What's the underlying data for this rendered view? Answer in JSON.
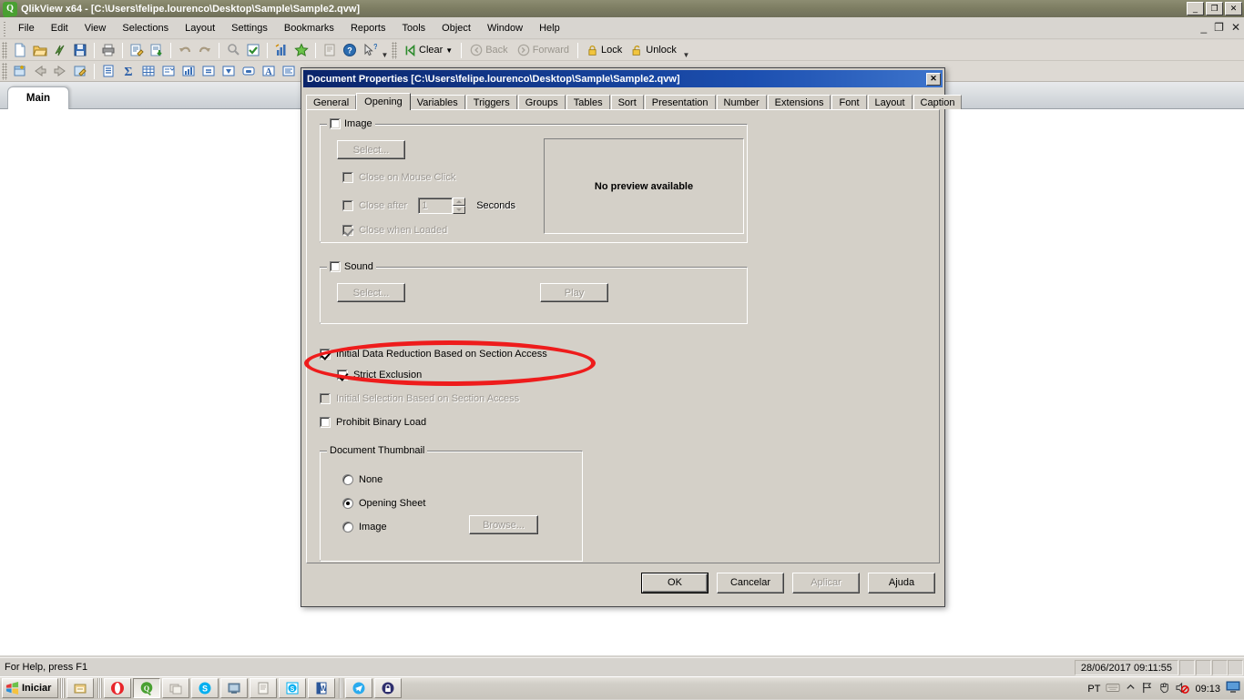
{
  "app": {
    "title": "QlikView x64 - [C:\\Users\\felipe.lourenco\\Desktop\\Sample\\Sample2.qvw]",
    "icon": "qlikview-logo-icon",
    "window_buttons": [
      {
        "name": "minimize",
        "glyph": "_"
      },
      {
        "name": "restore",
        "glyph": "❐"
      },
      {
        "name": "close",
        "glyph": "✕"
      }
    ],
    "mdi_buttons": [
      {
        "name": "minimize",
        "glyph": "_"
      },
      {
        "name": "restore",
        "glyph": "❐"
      },
      {
        "name": "close",
        "glyph": "✕"
      }
    ],
    "menu": [
      "File",
      "Edit",
      "View",
      "Selections",
      "Layout",
      "Settings",
      "Bookmarks",
      "Reports",
      "Tools",
      "Object",
      "Window",
      "Help"
    ],
    "toolbar_standard": [
      "new-document-icon",
      "open-document-icon",
      "reload-icon",
      "save-icon",
      "print-icon",
      "edit-script-icon",
      "load-data-icon",
      "undo-icon",
      "redo-icon",
      "search-icon",
      "current-selections-icon",
      "statistics-icon",
      "favorites-icon",
      "notes-icon",
      "help-icon",
      "context-help-icon"
    ],
    "toolbar_navigation": {
      "clear_label": "Clear",
      "back_label": "Back",
      "forward_label": "Forward",
      "lock_label": "Lock",
      "unlock_label": "Unlock"
    },
    "toolbar_design": [
      "new-sheet-icon",
      "promote-sheet-icon",
      "demote-sheet-icon",
      "sheet-properties-icon",
      "list-box-icon",
      "statistics-box-icon",
      "table-box-icon",
      "multi-box-icon",
      "chart-icon",
      "input-box-icon",
      "current-selections-box-icon",
      "button-icon",
      "text-object-icon",
      "slider-icon"
    ],
    "sheet_tabs": [
      {
        "label": "Main",
        "active": true
      }
    ],
    "status": {
      "help_text": "For Help, press F1",
      "clock": "28/06/2017 09:11:55"
    },
    "taskbar": {
      "start_label": "Iniciar",
      "items": [
        {
          "name": "windows-explorer-icon",
          "active": false
        },
        {
          "name": "opera-browser-icon",
          "active": false
        },
        {
          "name": "qlikview-icon",
          "active": true
        },
        {
          "name": "file-manager-icon",
          "active": false
        },
        {
          "name": "skype-icon",
          "active": false
        },
        {
          "name": "remote-desktop-icon",
          "active": false
        },
        {
          "name": "notepad-icon",
          "active": false
        },
        {
          "name": "skype-business-icon",
          "active": false
        },
        {
          "name": "word-icon",
          "active": false
        },
        {
          "name": "telegram-icon",
          "active": false
        },
        {
          "name": "lock-app-icon",
          "active": false
        }
      ],
      "tray_language": "PT",
      "tray_icons": [
        "keyboard-icon",
        "show-hidden-icons-icon",
        "flag-icon",
        "action-center-icon",
        "volume-muted-icon"
      ],
      "tray_clock": "09:13",
      "show-desktop": "show-desktop-icon"
    }
  },
  "dialog": {
    "title": "Document Properties [C:\\Users\\felipe.lourenco\\Desktop\\Sample\\Sample2.qvw]",
    "close_glyph": "✕",
    "tabs": [
      {
        "label": "General",
        "active": false
      },
      {
        "label": "Opening",
        "active": true
      },
      {
        "label": "Variables",
        "active": false
      },
      {
        "label": "Triggers",
        "active": false
      },
      {
        "label": "Groups",
        "active": false
      },
      {
        "label": "Tables",
        "active": false
      },
      {
        "label": "Sort",
        "active": false
      },
      {
        "label": "Presentation",
        "active": false
      },
      {
        "label": "Number",
        "active": false
      },
      {
        "label": "Extensions",
        "active": false
      },
      {
        "label": "Font",
        "active": false
      },
      {
        "label": "Layout",
        "active": false
      },
      {
        "label": "Caption",
        "active": false
      }
    ],
    "image_group": {
      "legend": "Image",
      "legend_checked": false,
      "legend_disabled": false,
      "select_button": "Select...",
      "select_disabled": true,
      "options": [
        {
          "label": "Close on Mouse Click",
          "checked": false,
          "disabled": true
        },
        {
          "label": "Close after",
          "checked": false,
          "disabled": true
        },
        {
          "label": "Close when Loaded",
          "checked": true,
          "disabled": true
        }
      ],
      "seconds_value": "1",
      "seconds_label": "Seconds",
      "preview_text": "No preview available"
    },
    "sound_group": {
      "legend": "Sound",
      "legend_checked": false,
      "select_button": "Select...",
      "select_disabled": true,
      "play_button": "Play",
      "play_disabled": true
    },
    "section_access": [
      {
        "label": "Initial Data Reduction Based on Section Access",
        "checked": true,
        "disabled": false,
        "indent": 0,
        "highlighted": true
      },
      {
        "label": "Strict Exclusion",
        "checked": true,
        "disabled": false,
        "indent": 1,
        "highlighted": true
      },
      {
        "label": "Initial Selection Based on Section Access",
        "checked": false,
        "disabled": true,
        "indent": 0,
        "highlighted": false
      },
      {
        "label": "Prohibit Binary Load",
        "checked": false,
        "disabled": false,
        "indent": 0,
        "highlighted": false
      }
    ],
    "thumbnail_group": {
      "legend": "Document Thumbnail",
      "options": [
        {
          "label": "None",
          "checked": false
        },
        {
          "label": "Opening Sheet",
          "checked": true
        },
        {
          "label": "Image",
          "checked": false
        }
      ],
      "browse_button": "Browse...",
      "browse_disabled": true
    },
    "footer_buttons": [
      {
        "label": "OK",
        "default": true,
        "disabled": false
      },
      {
        "label": "Cancelar",
        "default": false,
        "disabled": false
      },
      {
        "label": "Aplicar",
        "default": false,
        "disabled": true
      },
      {
        "label": "Ajuda",
        "default": false,
        "disabled": false
      }
    ]
  },
  "annotation": {
    "shape": "red-ellipse-highlight",
    "color": "#ee1c1c",
    "targets": [
      "Initial Data Reduction Based on Section Access",
      "Strict Exclusion"
    ]
  },
  "colors": {
    "dialog_face": "#d4d0c8",
    "titlebar_active": "#0a246a",
    "app_titlebar": "#7e7e63",
    "annotation_red": "#ee1c1c",
    "sheet_background": "#ffffff"
  }
}
